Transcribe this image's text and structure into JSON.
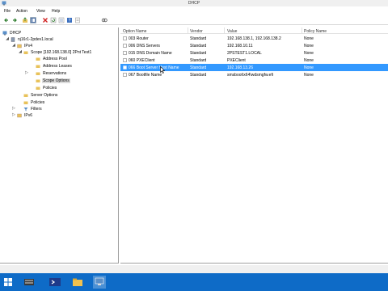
{
  "window": {
    "title": "DHCP"
  },
  "menu": [
    "File",
    "Action",
    "View",
    "Help"
  ],
  "toolbar": {
    "buttons": [
      "back-icon",
      "forward-icon",
      "up-icon",
      "show-hide-tree-icon",
      "delete-icon",
      "refresh-icon",
      "export-icon",
      "help-icon",
      "properties-icon",
      "link-icon"
    ]
  },
  "tree": {
    "root": "DHCP",
    "server": "nj16r1-2pdev1.local",
    "ipv4": "IPv4",
    "scope": "Scope [192.168.138.0] 2Pnt Test1",
    "address_pool": "Address Pool",
    "address_leases": "Address Leases",
    "reservations": "Reservations",
    "scope_options": "Scope Options",
    "policies": "Policies",
    "server_options": "Server Options",
    "server_policies": "Policies",
    "filters": "Filters",
    "ipv6": "IPv6"
  },
  "list": {
    "columns": [
      "Option Name",
      "Vendor",
      "Value",
      "Policy Name"
    ],
    "rows": [
      {
        "name": "003 Router",
        "vendor": "Standard",
        "value": "192.168.138.1, 192.168.138.2",
        "policy": "None"
      },
      {
        "name": "006 DNS Servers",
        "vendor": "Standard",
        "value": "192.168.10.11",
        "policy": "None"
      },
      {
        "name": "015 DNS Domain Name",
        "vendor": "Standard",
        "value": "2PSTEST1.LOCAL",
        "policy": "None"
      },
      {
        "name": "060 PXEClient",
        "vendor": "Standard",
        "value": "PXEClient",
        "policy": "None"
      },
      {
        "name": "066 Boot Server Host Name",
        "vendor": "Standard",
        "value": "192.168.13.26",
        "policy": "None"
      },
      {
        "name": "067 Bootfile Name",
        "vendor": "Standard",
        "value": "smsboot\\x64\\wdsmgfw.efi",
        "policy": "None"
      }
    ],
    "selected_row": 4
  },
  "taskbar": {
    "items": [
      "server-manager-icon",
      "powershell-icon",
      "file-explorer-icon",
      "dhcp-icon"
    ],
    "active": 3
  },
  "colors": {
    "selection": "#3399ff",
    "taskbar": "#0e6bc7",
    "tree_selection": "#dcdcdc"
  }
}
